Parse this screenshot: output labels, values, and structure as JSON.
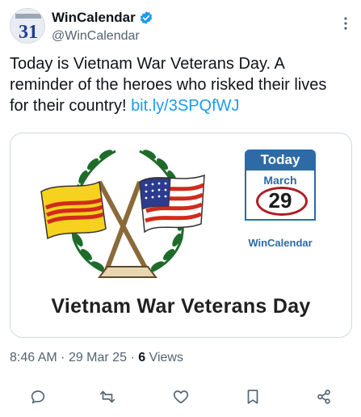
{
  "author": {
    "display_name": "WinCalendar",
    "handle": "@WinCalendar",
    "avatar_text": "31"
  },
  "tweet": {
    "text": "Today is Vietnam War Veterans Day. A reminder of the heroes who risked their lives for their country! ",
    "link": "bit.ly/3SPQfWJ"
  },
  "media": {
    "caption": "Vietnam War Veterans Day",
    "calendar": {
      "header": "Today",
      "month": "March",
      "day": "29",
      "brand": "WinCalendar"
    }
  },
  "meta": {
    "time": "8:46 AM",
    "date": "29 Mar 25",
    "views_count": "6",
    "views_label": "Views"
  },
  "icons": {
    "verified": "verified-badge-icon",
    "more": "more-icon",
    "reply": "reply-icon",
    "retweet": "retweet-icon",
    "like": "heart-icon",
    "bookmark": "bookmark-icon",
    "share": "share-icon"
  },
  "colors": {
    "accent": "#1d9bf0",
    "muted": "#536471",
    "calendar_blue": "#2d6aa6",
    "calendar_circle": "#b01c22"
  }
}
